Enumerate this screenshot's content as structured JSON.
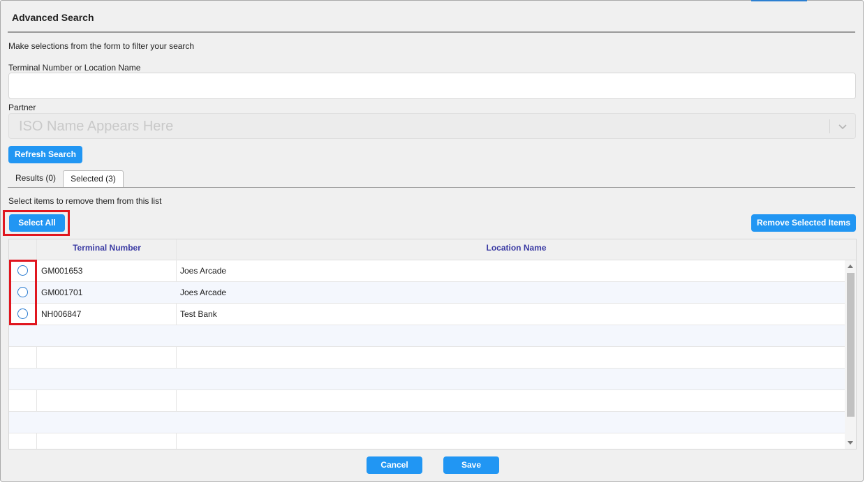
{
  "dialog": {
    "title": "Advanced Search",
    "instructions": "Make selections from the form to filter your search"
  },
  "form": {
    "terminal_label": "Terminal Number or Location Name",
    "terminal_value": "",
    "partner_label": "Partner",
    "partner_placeholder": "ISO Name Appears Here",
    "refresh_button": "Refresh Search"
  },
  "tabs": [
    {
      "label": "Results (0)",
      "active": false
    },
    {
      "label": "Selected (3)",
      "active": true
    }
  ],
  "selected_panel": {
    "instructions": "Select items to remove them from this list",
    "select_all_button": "Select All",
    "remove_button": "Remove Selected Items"
  },
  "table": {
    "columns": [
      "Terminal Number",
      "Location Name"
    ],
    "rows": [
      {
        "terminal": "GM001653",
        "location": "Joes Arcade"
      },
      {
        "terminal": "GM001701",
        "location": "Joes Arcade"
      },
      {
        "terminal": "NH006847",
        "location": "Test Bank"
      }
    ]
  },
  "footer": {
    "cancel_button": "Cancel",
    "save_button": "Save"
  },
  "colors": {
    "accent": "#2196f3",
    "highlight": "#e0161f",
    "header_text": "#3a3aa3"
  },
  "icons": [
    "chevron-down-icon",
    "scroll-up-arrow-icon",
    "scroll-down-arrow-icon",
    "radio-icon"
  ]
}
